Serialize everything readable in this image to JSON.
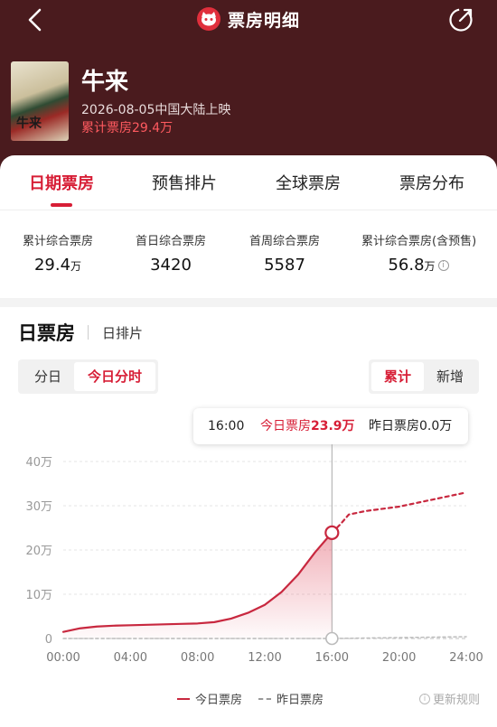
{
  "header": {
    "title": "票房明细"
  },
  "movie": {
    "name": "牛来",
    "poster_text": "牛来",
    "release": "2026-08-05中国大陆上映",
    "cumulative": "累计票房29.4万"
  },
  "tabs": [
    {
      "label": "日期票房",
      "active": true
    },
    {
      "label": "预售排片"
    },
    {
      "label": "全球票房"
    },
    {
      "label": "票房分布"
    }
  ],
  "stats": [
    {
      "label": "累计综合票房",
      "value": "29.4",
      "unit": "万"
    },
    {
      "label": "首日综合票房",
      "value": "3420",
      "unit": ""
    },
    {
      "label": "首周综合票房",
      "value": "5587",
      "unit": ""
    },
    {
      "label": "累计综合票房(含预售)",
      "value": "56.8",
      "unit": "万"
    }
  ],
  "section": {
    "title": "日票房",
    "sub": "日排片"
  },
  "mode_toggle": {
    "options": [
      "分日",
      "今日分时"
    ],
    "selected": "今日分时"
  },
  "metric_toggle": {
    "options": [
      "累计",
      "新增"
    ],
    "selected": "累计"
  },
  "tooltip": {
    "time": "16:00",
    "today_label": "今日票房",
    "today_value": "23.9万",
    "yesterday_label": "昨日票房",
    "yesterday_value": "0.0万"
  },
  "legend": {
    "today": "今日票房",
    "yesterday": "昨日票房"
  },
  "rules_link": "更新规则",
  "colors": {
    "accent": "#d71e36",
    "hero_bg": "#4a1b1e"
  },
  "chart_data": {
    "type": "line",
    "x_ticks": [
      "00:00",
      "04:00",
      "08:00",
      "12:00",
      "16:00",
      "20:00",
      "24:00"
    ],
    "y_ticks": [
      "0",
      "10万",
      "20万",
      "30万",
      "40万"
    ],
    "ylim": [
      0,
      40
    ],
    "grid": true,
    "legend_placement": "bottom",
    "series": [
      {
        "name": "今日票房",
        "style": "solid",
        "points": [
          [
            0,
            1.5
          ],
          [
            1,
            2.3
          ],
          [
            2,
            2.7
          ],
          [
            3,
            2.9
          ],
          [
            4,
            3.0
          ],
          [
            5,
            3.1
          ],
          [
            6,
            3.2
          ],
          [
            7,
            3.3
          ],
          [
            8,
            3.4
          ],
          [
            9,
            3.7
          ],
          [
            10,
            4.5
          ],
          [
            11,
            5.8
          ],
          [
            12,
            7.6
          ],
          [
            13,
            10.5
          ],
          [
            14,
            14.5
          ],
          [
            15,
            19.5
          ],
          [
            16,
            23.9
          ]
        ]
      },
      {
        "name": "今日票房",
        "style": "dashed",
        "points": [
          [
            16,
            23.9
          ],
          [
            16.5,
            25.8
          ],
          [
            17,
            28.0
          ],
          [
            18,
            28.8
          ],
          [
            20,
            29.8
          ],
          [
            22,
            31.4
          ],
          [
            24,
            33.0
          ]
        ]
      },
      {
        "name": "昨日票房",
        "style": "dashed",
        "points": [
          [
            0,
            0
          ],
          [
            16,
            0.0
          ],
          [
            24,
            0.4
          ]
        ]
      }
    ],
    "highlight_x": 16
  }
}
